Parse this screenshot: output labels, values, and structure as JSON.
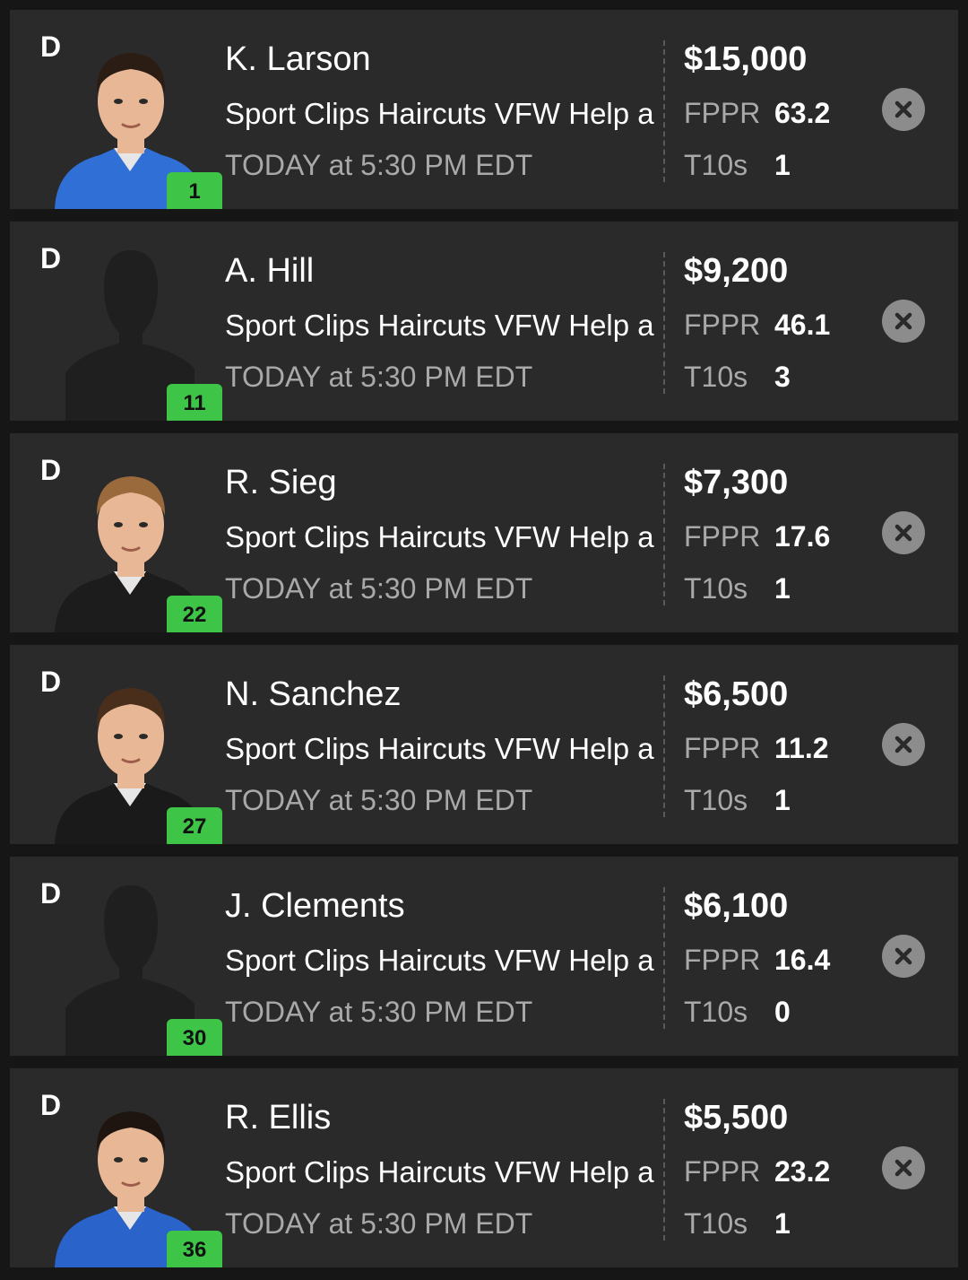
{
  "players": [
    {
      "position": "D",
      "name": "K. Larson",
      "event": "Sport Clips Haircuts VFW Help a",
      "time": "TODAY at 5:30 PM EDT",
      "salary": "$15,000",
      "fppr_label": "FPPR",
      "fppr": "63.2",
      "t10_label": "T10s",
      "t10": "1",
      "car_number": "1",
      "photo": "driver-photo",
      "suit_color": "#2f6fd6",
      "hair_color": "#2b1d14"
    },
    {
      "position": "D",
      "name": "A. Hill",
      "event": "Sport Clips Haircuts VFW Help a",
      "time": "TODAY at 5:30 PM EDT",
      "salary": "$9,200",
      "fppr_label": "FPPR",
      "fppr": "46.1",
      "t10_label": "T10s",
      "t10": "3",
      "car_number": "11",
      "photo": "silhouette"
    },
    {
      "position": "D",
      "name": "R. Sieg",
      "event": "Sport Clips Haircuts VFW Help a",
      "time": "TODAY at 5:30 PM EDT",
      "salary": "$7,300",
      "fppr_label": "FPPR",
      "fppr": "17.6",
      "t10_label": "T10s",
      "t10": "1",
      "car_number": "22",
      "photo": "driver-photo",
      "suit_color": "#1c1c1c",
      "hair_color": "#9a6a3c"
    },
    {
      "position": "D",
      "name": "N. Sanchez",
      "event": "Sport Clips Haircuts VFW Help a",
      "time": "TODAY at 5:30 PM EDT",
      "salary": "$6,500",
      "fppr_label": "FPPR",
      "fppr": "11.2",
      "t10_label": "T10s",
      "t10": "1",
      "car_number": "27",
      "photo": "driver-photo",
      "suit_color": "#1a1a1a",
      "hair_color": "#4a2e1c"
    },
    {
      "position": "D",
      "name": "J. Clements",
      "event": "Sport Clips Haircuts VFW Help a",
      "time": "TODAY at 5:30 PM EDT",
      "salary": "$6,100",
      "fppr_label": "FPPR",
      "fppr": "16.4",
      "t10_label": "T10s",
      "t10": "0",
      "car_number": "30",
      "photo": "silhouette"
    },
    {
      "position": "D",
      "name": "R. Ellis",
      "event": "Sport Clips Haircuts VFW Help a",
      "time": "TODAY at 5:30 PM EDT",
      "salary": "$5,500",
      "fppr_label": "FPPR",
      "fppr": "23.2",
      "t10_label": "T10s",
      "t10": "1",
      "car_number": "36",
      "photo": "driver-photo",
      "suit_color": "#2a63c9",
      "hair_color": "#1e1510"
    }
  ],
  "theme": {
    "card_bg": "#2a2a2a",
    "page_bg": "#161616",
    "badge_green": "#3ec548",
    "muted_text": "#a9a9a9",
    "remove_button": "#8c8c8c",
    "silhouette": "#1f1f1f",
    "skin": "#e8b896"
  },
  "icons": {
    "remove": "close-icon",
    "photo": "avatar"
  }
}
